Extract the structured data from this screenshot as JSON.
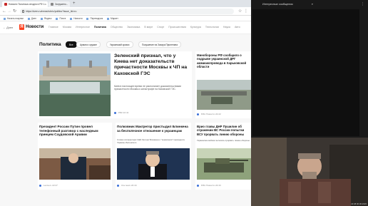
{
  "browser": {
    "tabs": [
      {
        "label": "Новости Политика сегодня в РФ 1..."
      },
      {
        "label": "Загружено..."
      }
    ],
    "url": "https://dzen.ru/news/rubric/politics?issue_tld=ru",
    "bookmarks": [
      "Начать покупки",
      "Дзен",
      "Яндекс",
      "Почта",
      "Новости",
      "Переводчик",
      "Маркет"
    ]
  },
  "site": {
    "back": "← Дзен",
    "logo_mark": "Я",
    "logo": "Новости",
    "nav": [
      "Главное",
      "Москва",
      "Интересное",
      "Политика",
      "Общество",
      "Экономика",
      "В мире",
      "Спорт",
      "Происшествия",
      "Культура",
      "Технологии",
      "Наука",
      "Авто"
    ],
    "active_nav": "Политика"
  },
  "section": {
    "title": "Политика",
    "chips": [
      "Все",
      "Армия и оружие",
      "Украинский кризис",
      "Покушение на Захара Прилепина"
    ]
  },
  "cards": {
    "main": {
      "headline": "Зеленский признал, что у Киева нет доказательств причастности Москвы к ЧП на Каховской ГЭС",
      "annotation": "Киев в настоящее время не располагает доказательствами причастности Москвы к катастрофе на Каховской ГЭС.",
      "source": "РБК",
      "time": "22:41"
    },
    "side1": {
      "headline": "Минобороны РФ сообщило о подрыве украинской ДРГ аммиакопровода в Харьковской области",
      "source": "РИА Новости",
      "time": "22:22"
    },
    "row": [
      {
        "headline": "Президент России Путин провел телефонный разговор с наследным принцем Саудовской Аравии",
        "source": "Lenta.ru",
        "time": "22:47"
      },
      {
        "headline": "Полковник Макгрегор пристыдил Блинкена за бесполезное отношение к украинцам",
        "annotation": "Слова госсекретаря США Энтони Блинкена о \"кормлении\" президента Украины Зеленского",
        "source": "Ura.news",
        "time": "22:44"
      },
      {
        "headline": "Врио главы ДНР Пушилин об отражении ВС России попытки ВСУ прорвать линию обороны",
        "annotation": "Украинские войска пытались прорвать линию обороны",
        "source": "РИА Новости",
        "time": "22:43"
      }
    ]
  },
  "overlay": {
    "title": "Интересные сообщения",
    "clock": "22:48 06.06.2023"
  }
}
